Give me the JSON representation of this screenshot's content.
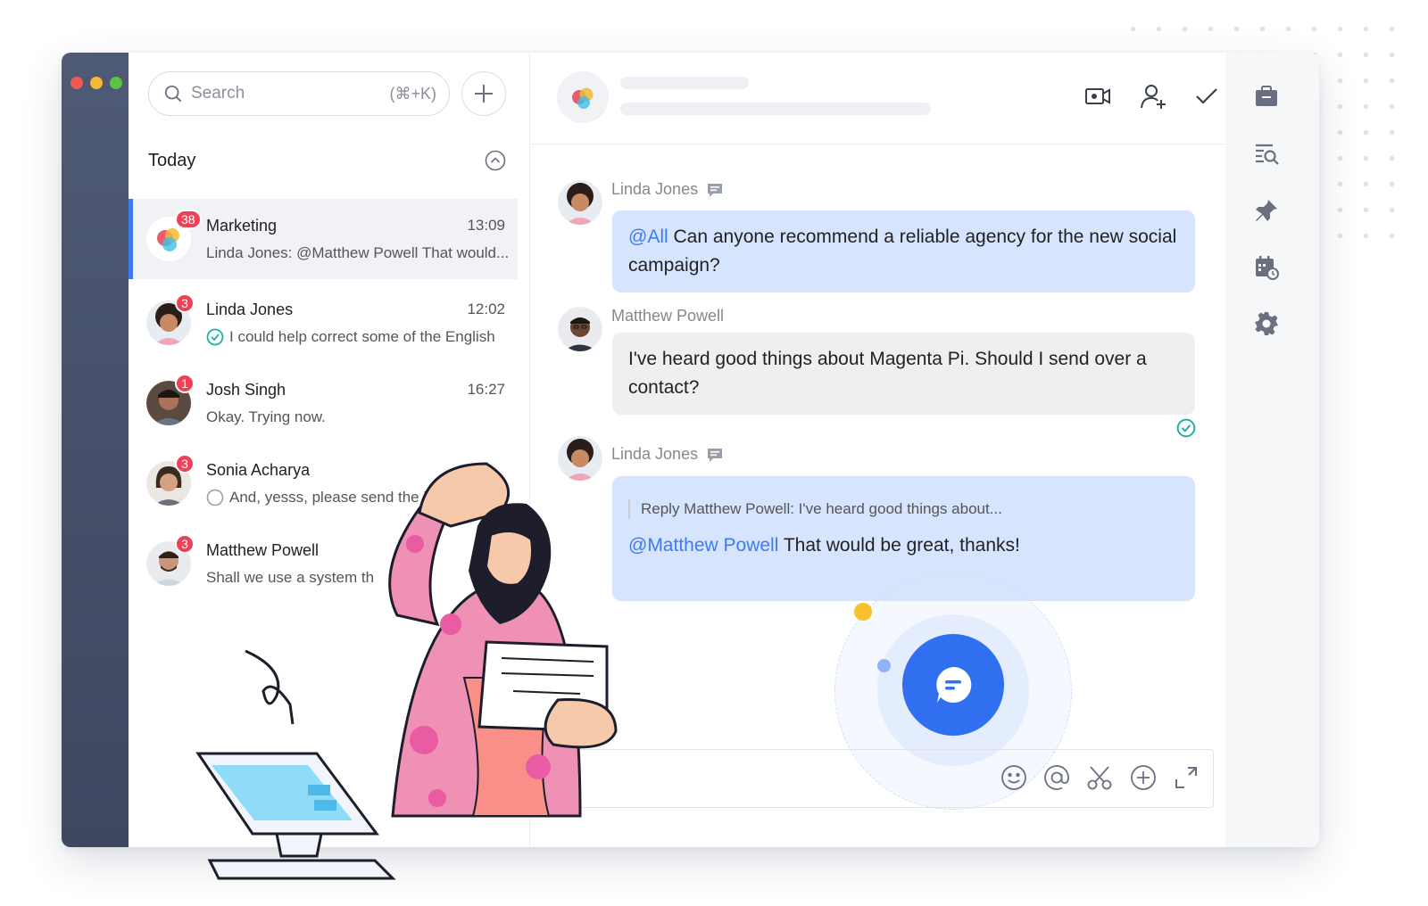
{
  "window": {
    "traffic_lights": [
      "#ee5a52",
      "#f5b937",
      "#5bc243"
    ]
  },
  "sidebar": {
    "search": {
      "label": "Search",
      "shortcut": "(⌘+K)",
      "icon": "search-icon"
    },
    "add_icon": "plus-icon",
    "section_title": "Today",
    "collapse_icon": "chevron-up-circle-icon",
    "conversations": [
      {
        "name": "Marketing",
        "time": "13:09",
        "badge": "38",
        "preview": "Linda Jones: @Matthew Powell That would...",
        "status": "none",
        "active": true
      },
      {
        "name": "Linda Jones",
        "time": "12:02",
        "badge": "3",
        "preview": "I could help correct some of the English",
        "status": "read"
      },
      {
        "name": "Josh Singh",
        "time": "16:27",
        "badge": "1",
        "preview": "Okay. Trying now.",
        "status": "none"
      },
      {
        "name": "Sonia Acharya",
        "time": "",
        "badge": "3",
        "preview": "And, yesss, please send the info",
        "status": "unread"
      },
      {
        "name": "Matthew Powell",
        "time": "",
        "badge": "3",
        "preview": "Shall we use a system th",
        "status": "none"
      }
    ]
  },
  "chat": {
    "header_icons": [
      "video-call-icon",
      "add-user-icon",
      "checkmark-icon"
    ],
    "messages": [
      {
        "sender": "Linda Jones",
        "mention": "@All",
        "text": " Can anyone recommend a reliable agency for the new social campaign?",
        "style": "blue"
      },
      {
        "sender": "Matthew Powell",
        "mention": "",
        "text": "I've heard good things about Magenta Pi. Should I send over a contact?",
        "style": "gray"
      },
      {
        "sender": "Linda Jones",
        "quote": "Reply Matthew Powell: I've heard good things about...",
        "mention": "@Matthew Powell",
        "text": " That would be great, thanks!",
        "style": "blue"
      }
    ],
    "toolbar": [
      "emoji-icon",
      "at-mention-icon",
      "scissors-icon",
      "add-circle-icon",
      "expand-icon"
    ]
  },
  "right_rail": [
    "briefcase-icon",
    "search-document-icon",
    "pin-icon",
    "calendar-icon",
    "settings-gear-icon"
  ],
  "colors": {
    "accent": "#3d7bf5",
    "badge": "#ef4055",
    "bubble_blue": "#d6e4fd",
    "bubble_gray": "#efeff1",
    "rail_dark": "#4f5a75"
  }
}
